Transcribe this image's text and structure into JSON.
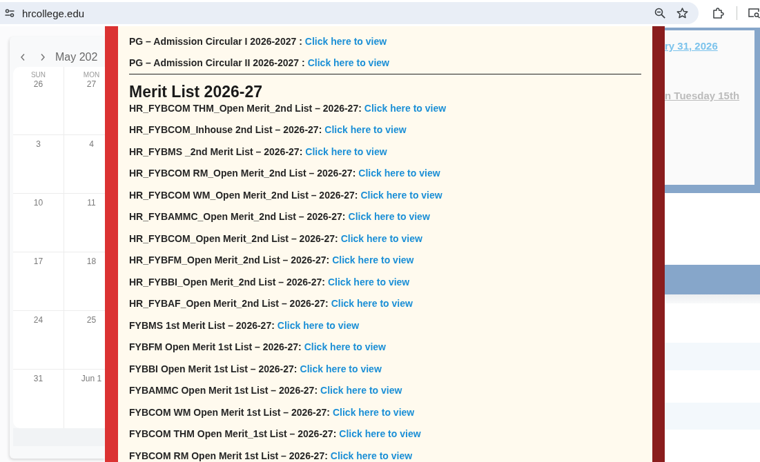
{
  "browser": {
    "url": "hrcollege.edu"
  },
  "calendar": {
    "month": "May 202",
    "weekdays": [
      "SUN",
      "MON"
    ],
    "weeks": [
      [
        "26",
        "27"
      ],
      [
        "3",
        "4"
      ],
      [
        "10",
        "11"
      ],
      [
        "17",
        "18"
      ],
      [
        "24",
        "25"
      ],
      [
        "31",
        "Jun 1"
      ]
    ]
  },
  "modal": {
    "notices": [
      {
        "title": "PG – Admission Circular I 2026-2027 :",
        "link": "Click here to view"
      },
      {
        "title": "PG – Admission Circular II 2026-2027 :",
        "link": "Click here to view"
      }
    ],
    "section_title": "Merit List 2026-27",
    "merit_list": [
      {
        "title": "HR_FYBCOM THM_Open Merit_2nd List – 2026-27:",
        "link": "Click here to view"
      },
      {
        "title": "HR_FYBCOM_Inhouse 2nd List – 2026-27:",
        "link": "Click here to view"
      },
      {
        "title": "HR_FYBMS _2nd Merit List – 2026-27:",
        "link": "Click here to view"
      },
      {
        "title": "HR_FYBCOM RM_Open Merit_2nd List – 2026-27:",
        "link": "Click here to view"
      },
      {
        "title": "HR_FYBCOM WM_Open Merit_2nd List – 2026-27:",
        "link": "Click here to view"
      },
      {
        "title": "HR_FYBAMMC_Open Merit_2nd List – 2026-27:",
        "link": "Click here to view"
      },
      {
        "title": "HR_FYBCOM_Open Merit_2nd List – 2026-27:",
        "link": "Click here to view"
      },
      {
        "title": "HR_FYBFM_Open Merit_2nd List – 2026-27:",
        "link": "Click here to view"
      },
      {
        "title": "HR_FYBBI_Open Merit_2nd List – 2026-27:",
        "link": "Click here to view"
      },
      {
        "title": "HR_FYBAF_Open Merit_2nd List – 2026-27:",
        "link": "Click here to view"
      },
      {
        "title": "FYBMS 1st Merit List – 2026-27:",
        "link": "Click here to view"
      },
      {
        "title": "FYBFM Open Merit 1st List – 2026-27:",
        "link": "Click here to view"
      },
      {
        "title": "FYBBI Open Merit 1st List – 2026-27:",
        "link": "Click here to view"
      },
      {
        "title": "FYBAMMC Open Merit 1st List – 2026-27:",
        "link": "Click here to view"
      },
      {
        "title": "FYBCOM WM Open Merit 1st List – 2026-27:",
        "link": "Click here to view"
      },
      {
        "title": "FYBCOM THM Open Merit_1st List – 2026-27:",
        "link": "Click here to view"
      },
      {
        "title": "FYBCOM RM Open Merit 1st List – 2026-27:",
        "link": "Click here to view"
      }
    ]
  },
  "background_notices": [
    {
      "kind": "link",
      "text": "ry 31, 2026"
    },
    {
      "kind": "muted",
      "text": "n Tuesday 15th"
    }
  ]
}
